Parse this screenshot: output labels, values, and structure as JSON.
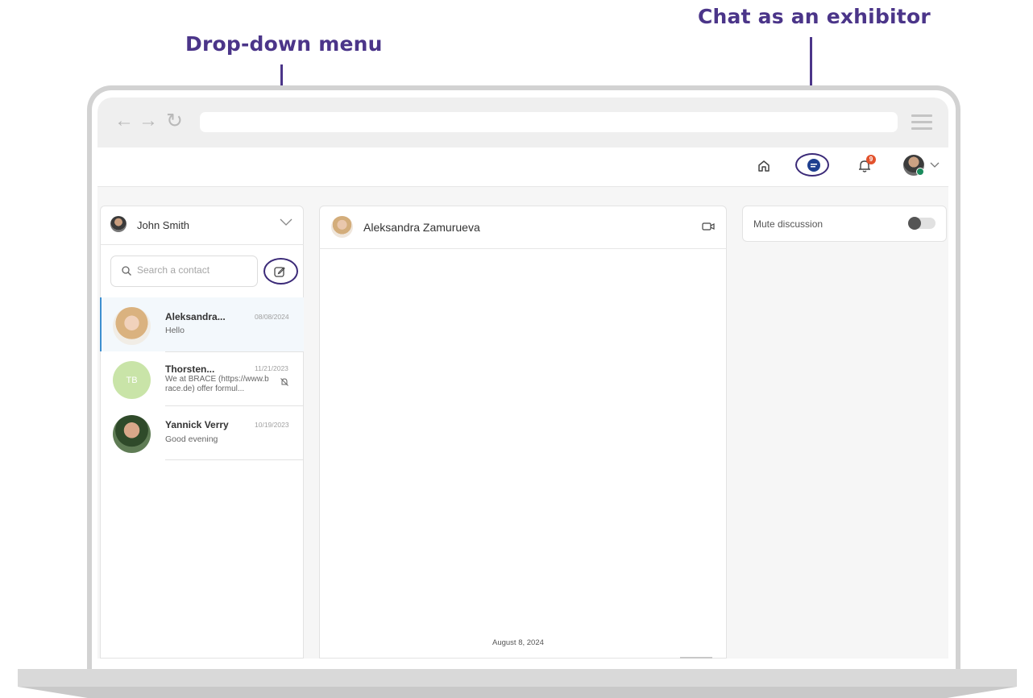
{
  "annotations": {
    "dropdown_label": "Drop-down menu",
    "chat_label": "Chat as an exhibitor"
  },
  "header": {
    "icons": [
      "home-icon",
      "chat-icon",
      "bell-icon",
      "user-avatar",
      "chevron-down-icon"
    ],
    "notification_count": "9",
    "chat_icon_color": "#1f3f8f",
    "badge_color": "#e2522d"
  },
  "account": {
    "name": "John Smith"
  },
  "search": {
    "placeholder": "Search a contact"
  },
  "contacts": [
    {
      "name": "Aleksandra...",
      "date": "08/08/2024",
      "message": "Hello",
      "active": true
    },
    {
      "name": "Thorsten...",
      "date": "11/21/2023",
      "message": "We at BRACE (https://www.brace.de) offer formul...",
      "initials": "TB",
      "muted": true
    },
    {
      "name": "Yannick Verry",
      "date": "10/19/2023",
      "message": "Good evening"
    }
  ],
  "chat": {
    "contact_name": "Aleksandra Zamurueva",
    "date_separator": "August 8, 2024"
  },
  "settings": {
    "mute_label": "Mute discussion",
    "mute_enabled": false
  },
  "colors": {
    "annotation": "#4b3589",
    "active_contact_border": "#3d8fd0"
  }
}
